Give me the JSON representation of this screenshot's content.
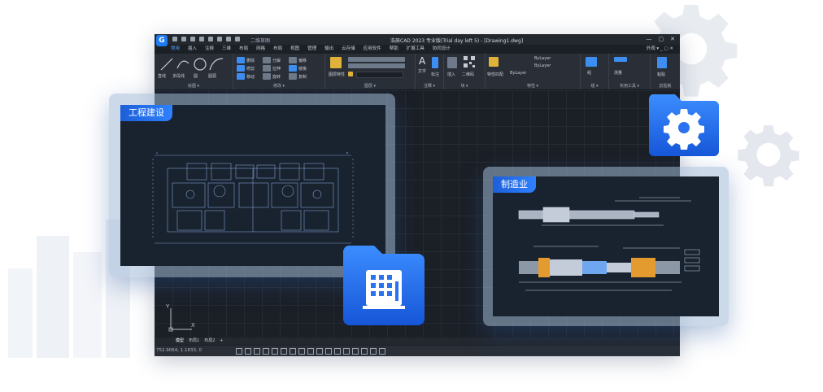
{
  "app": {
    "logo_letter": "G",
    "doc_tab": "二维草图",
    "window_title": "浩辰CAD 2023 专业版(Trial day left 5) - [Drawing1.dwg]",
    "window_controls": [
      "—",
      "▢",
      "✕"
    ],
    "menus": [
      "常用",
      "插入",
      "注释",
      "三维",
      "布局",
      "网格",
      "布局",
      "视图",
      "管理",
      "输出",
      "云存储",
      "应用软件",
      "帮助",
      "扩展工具",
      "协同设计"
    ],
    "active_menu_index": 0,
    "menu_right": "外观 ▾  _ ▢ ✕"
  },
  "ribbon": {
    "groups": [
      {
        "label": "绘图 ▾",
        "buttons": [
          "直线",
          "多段线",
          "圆",
          "圆弧"
        ]
      },
      {
        "label": "修改 ▾",
        "buttons": [
          "删除",
          "分解",
          "偏移",
          "修剪",
          "拉伸",
          "镜像",
          "移动",
          "旋转",
          "复制"
        ]
      },
      {
        "label": "图层 ▾",
        "buttons": [
          "图层特性"
        ]
      },
      {
        "label": "注释 ▾",
        "buttons": [
          "文字",
          "标注"
        ]
      },
      {
        "label": "块 ▾",
        "buttons": [
          "插入",
          "二维码"
        ]
      },
      {
        "label": "特性 ▾",
        "buttons": [
          "特性匹配",
          "ByLayer",
          "ByLayer",
          "ByLayer"
        ]
      },
      {
        "label": "组 ▾",
        "buttons": [
          "组"
        ]
      },
      {
        "label": "实用工具 ▾",
        "buttons": [
          "测量"
        ]
      },
      {
        "label": "剪贴板",
        "buttons": [
          "粘贴"
        ]
      }
    ]
  },
  "layout_tabs": [
    "模型",
    "布局1",
    "布局2",
    "+"
  ],
  "status": {
    "coords": "752.9064, 1.1833, 0"
  },
  "axis": {
    "y": "Y",
    "x": "X"
  },
  "cards": {
    "architecture": {
      "label": "工程建设"
    },
    "manufacturing": {
      "label": "制造业"
    }
  },
  "colors": {
    "accent": "#2f80ff",
    "cad_bg": "#1b1f26",
    "drawing_line": "#8fb4e6"
  }
}
